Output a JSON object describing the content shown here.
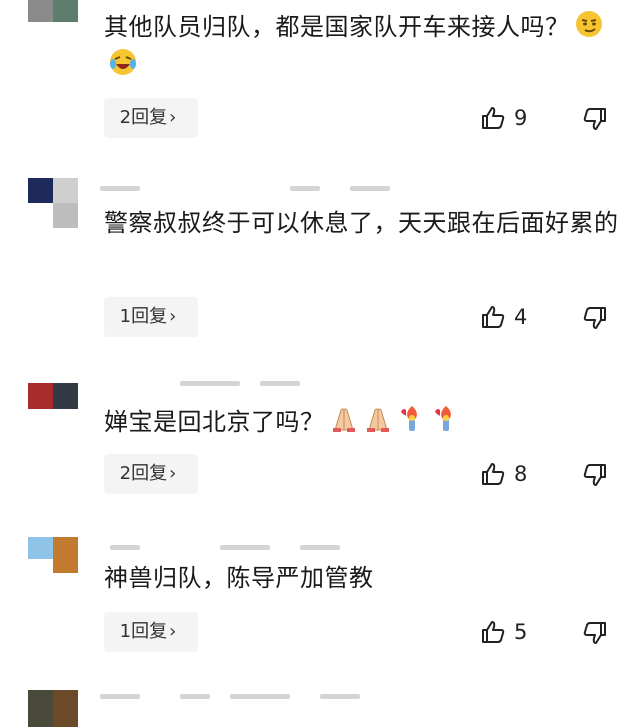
{
  "comments": [
    {
      "text": "其他队员归队，都是国家队开车来接人吗？",
      "emojis": [
        "smirk-emoji",
        "laugh-cry-emoji"
      ],
      "reply_label": "2回复",
      "likes": "9",
      "avatar_colors": [
        "#8a8a8a",
        "#5e7d6d"
      ]
    },
    {
      "text": "警察叔叔终于可以休息了，天天跟在后面好累的",
      "emojis": [],
      "reply_label": "1回复",
      "likes": "4",
      "avatar_colors": [
        "#1e2a5c",
        "#bdbdbd"
      ]
    },
    {
      "text": "婵宝是回北京了吗？",
      "emojis": [
        "praying-hands-emoji",
        "praying-hands-emoji",
        "torch-heart-emoji",
        "torch-heart-emoji"
      ],
      "reply_label": "2回复",
      "likes": "8",
      "avatar_colors": [
        "#a82c2c",
        "#333a45"
      ]
    },
    {
      "text": "神兽归队，陈导严加管教",
      "emojis": [],
      "reply_label": "1回复",
      "likes": "5",
      "avatar_colors": [
        "#8fc4e8",
        "#c27a2e"
      ]
    }
  ],
  "colors": {
    "reply_bg": "#f4f4f5",
    "icon_stroke": "#222222"
  }
}
